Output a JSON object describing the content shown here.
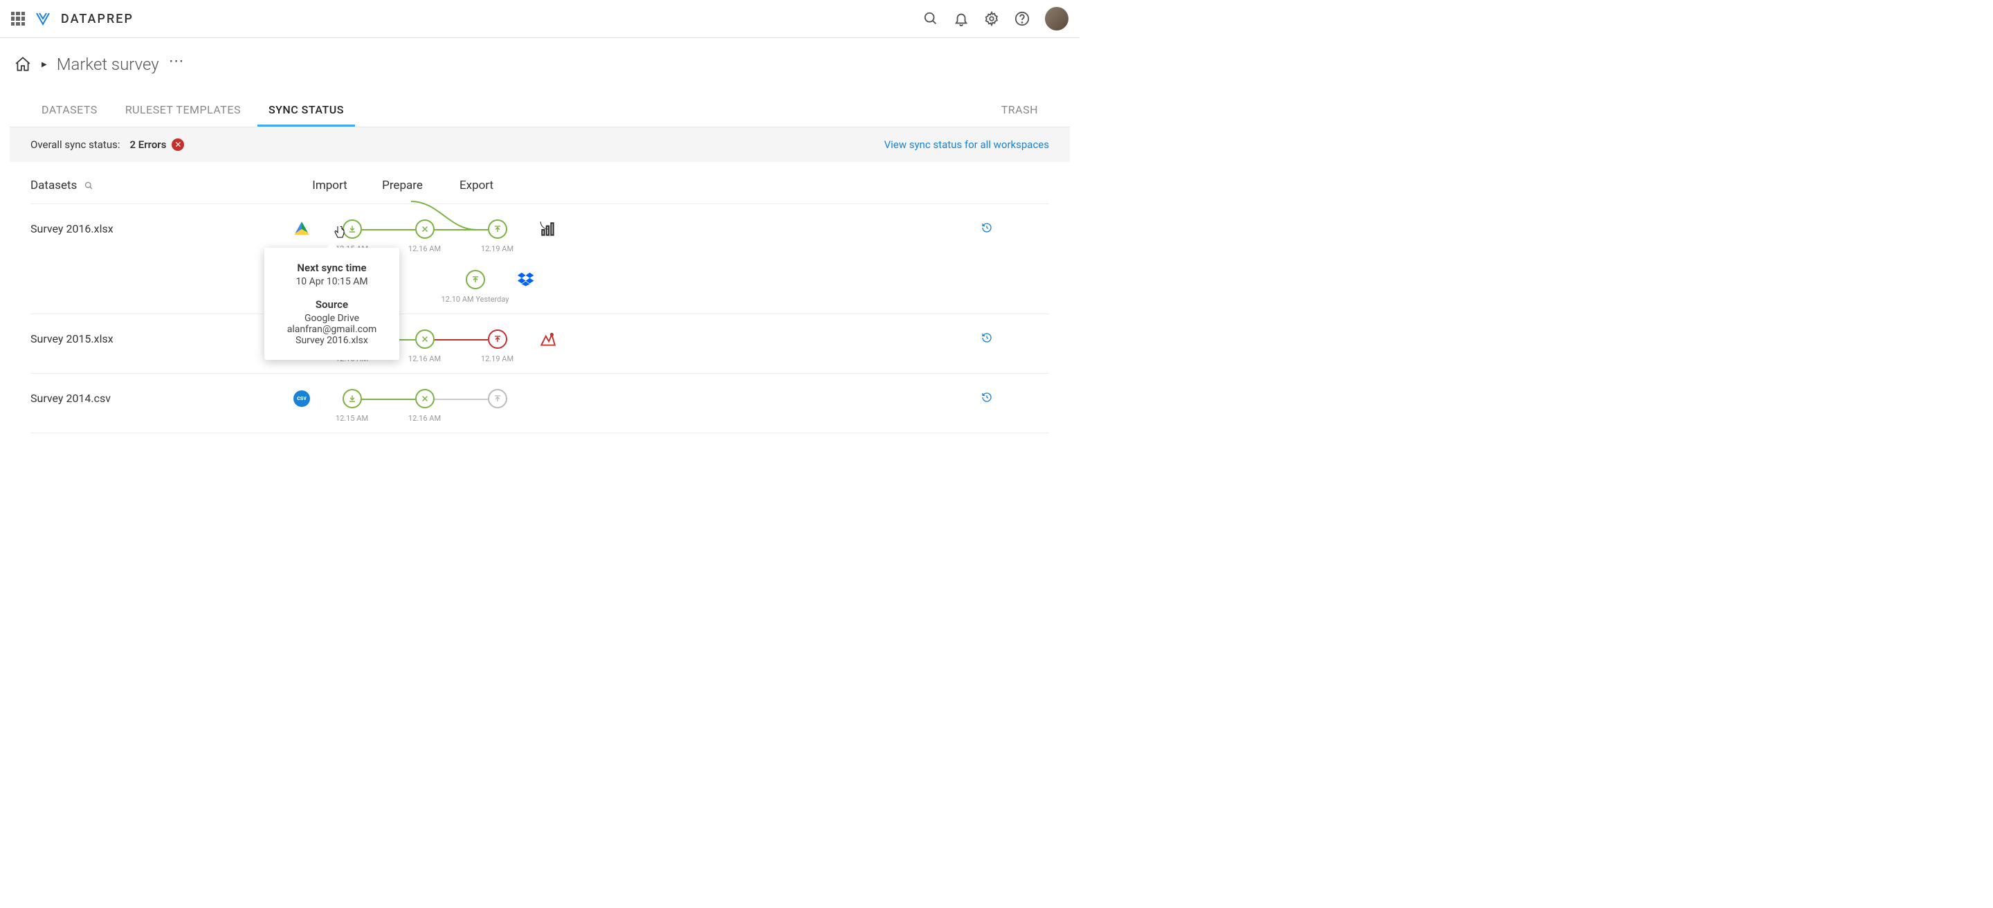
{
  "header": {
    "app_name": "DATAPREP"
  },
  "breadcrumb": {
    "title": "Market survey"
  },
  "tabs": {
    "datasets": "DATASETS",
    "ruleset": "RULESET TEMPLATES",
    "sync_status": "SYNC STATUS",
    "trash": "TRASH"
  },
  "overall": {
    "label": "Overall sync status:",
    "value": "2 Errors",
    "link": "View sync status for all workspaces"
  },
  "columns": {
    "datasets": "Datasets",
    "import": "Import",
    "prepare": "Prepare",
    "export": "Export"
  },
  "rows": [
    {
      "name": "Survey 2016.xlsx",
      "import_time": "12.15 AM",
      "prepare_time": "12.16 AM",
      "export_time": "12.19 AM",
      "branch_time": "12.10 AM Yesterday"
    },
    {
      "name": "Survey 2015.xlsx",
      "import_time": "12.15 AM",
      "prepare_time": "12.16 AM",
      "export_time": "12.19 AM"
    },
    {
      "name": "Survey 2014.csv",
      "import_time": "12.15 AM",
      "prepare_time": "12.16 AM",
      "export_time": ""
    }
  ],
  "tooltip": {
    "next_sync_label": "Next sync time",
    "next_sync_value": "10 Apr 10:15 AM",
    "source_label": "Source",
    "source_service": "Google Drive",
    "source_account": "alanfran@gmail.com",
    "source_file": "Survey 2016.xlsx"
  }
}
